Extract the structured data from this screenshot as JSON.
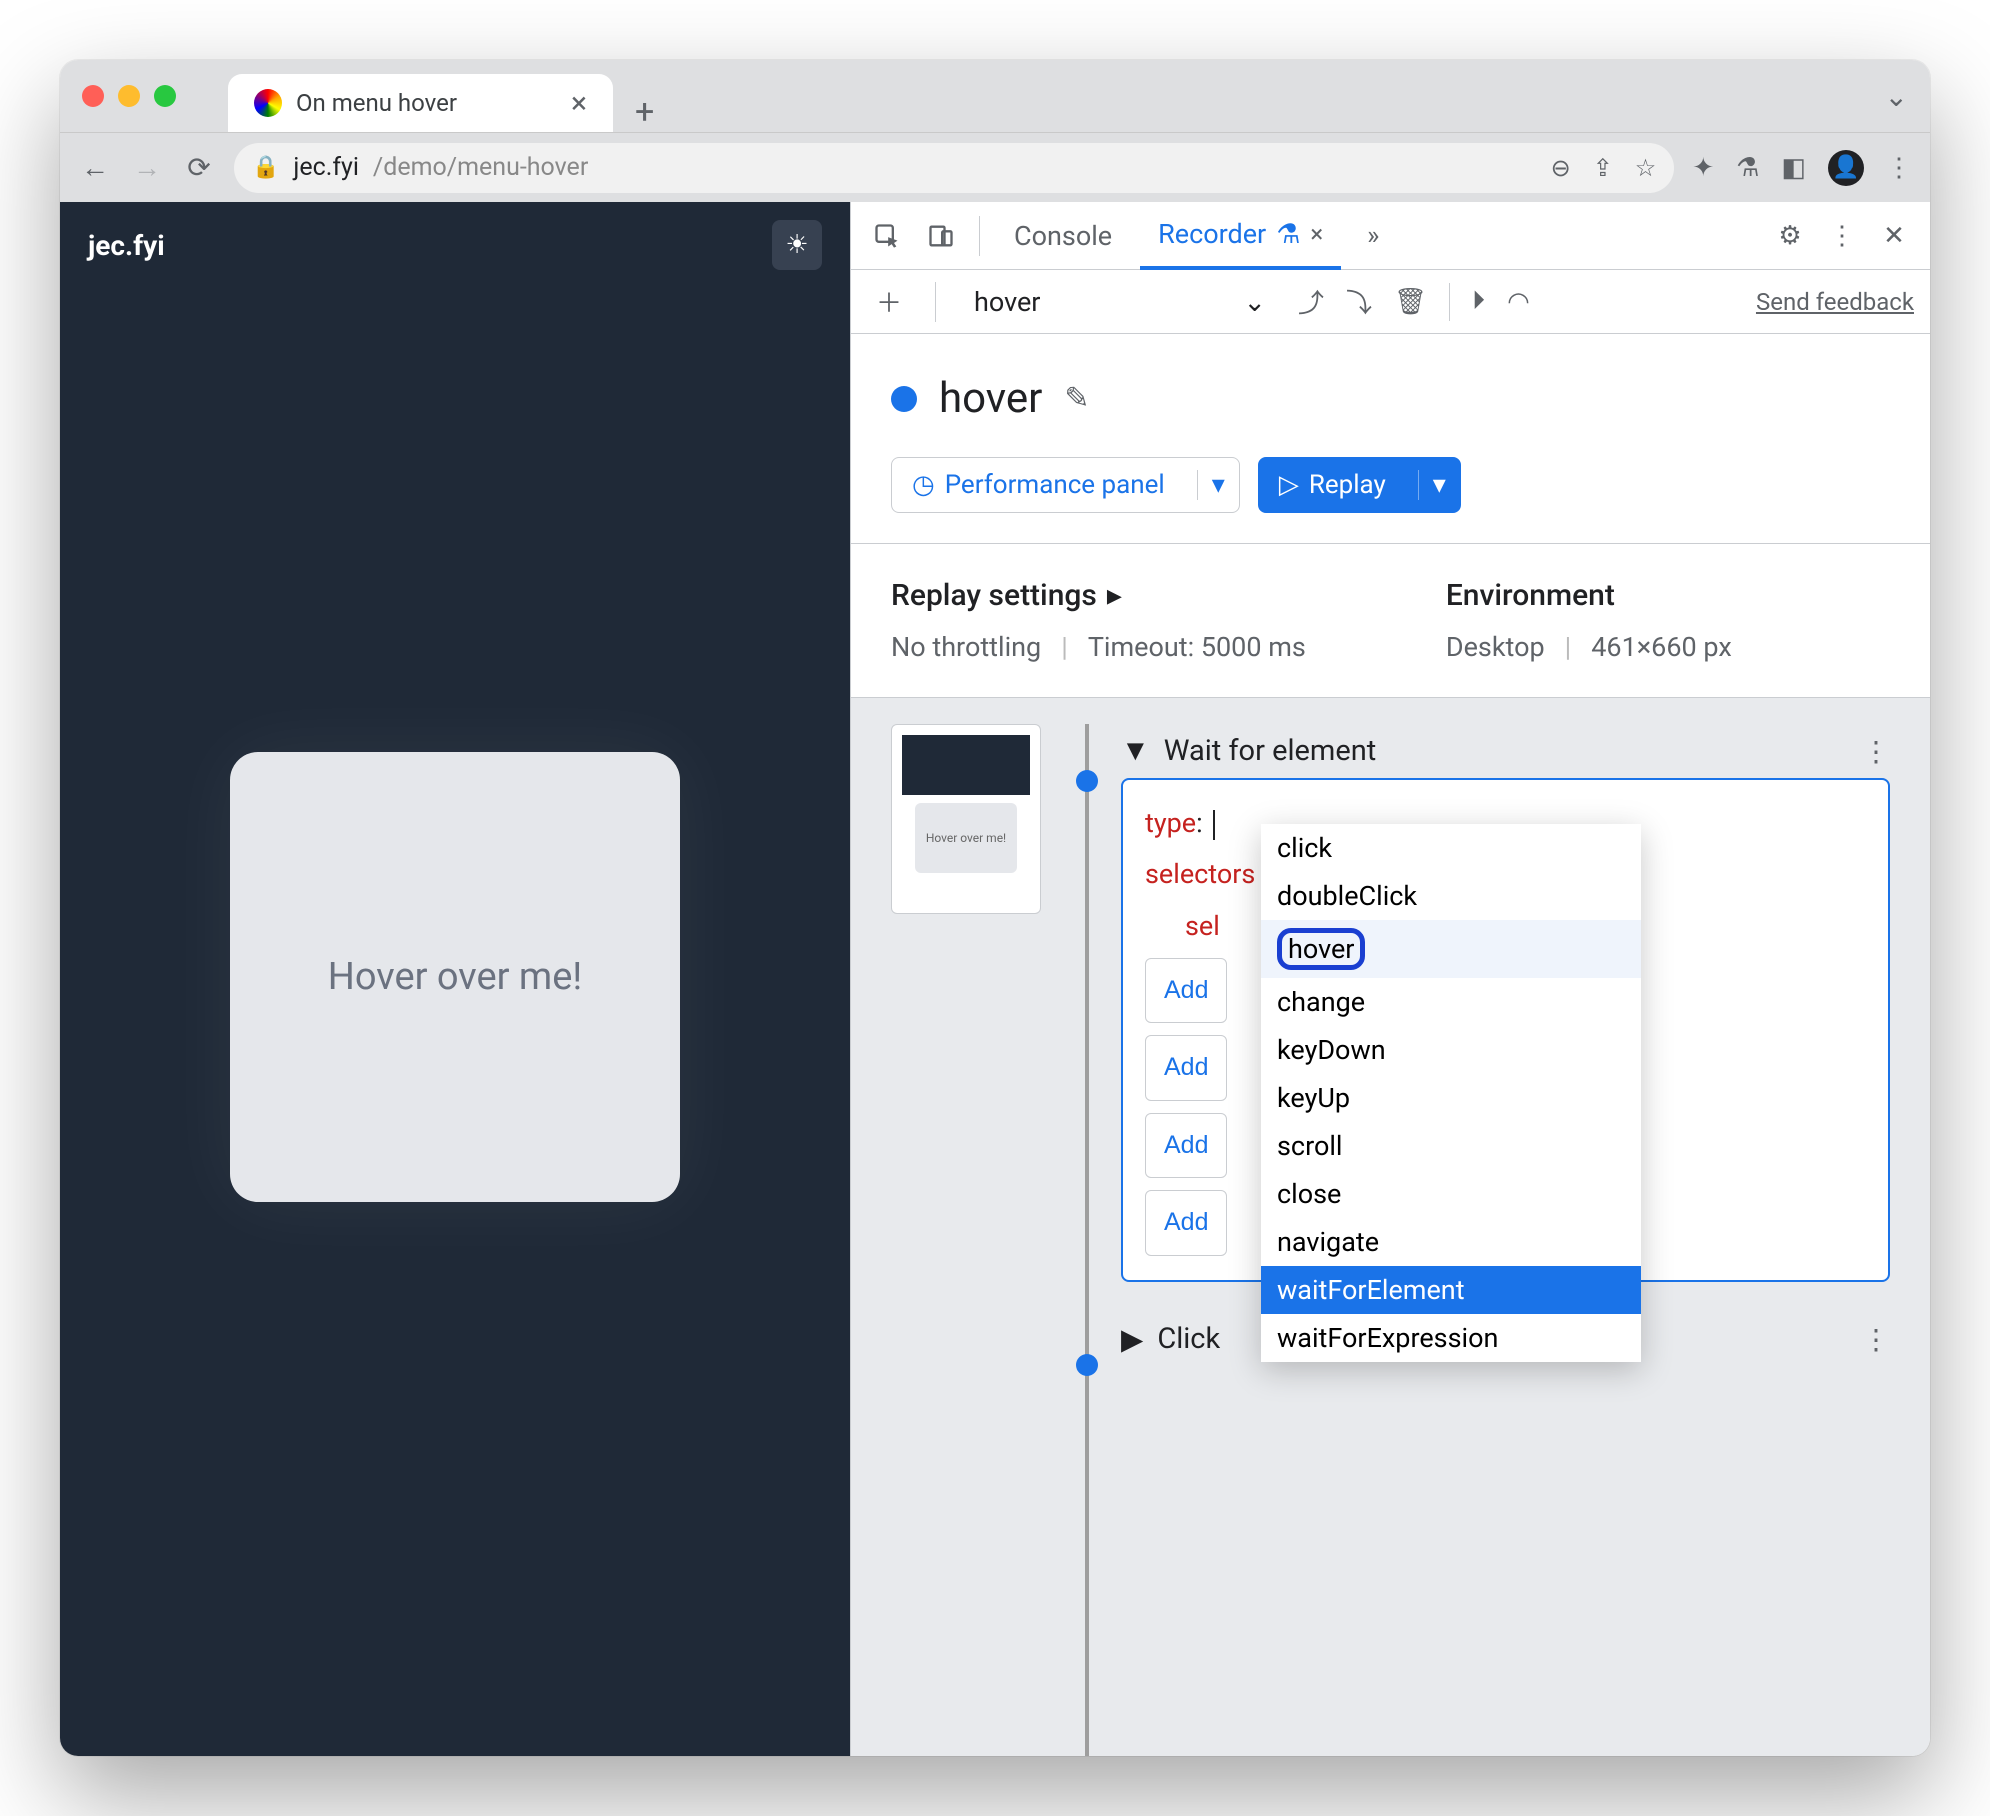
{
  "browser_tab": {
    "title": "On menu hover"
  },
  "address": {
    "domain": "jec.fyi",
    "path": "/demo/menu-hover"
  },
  "page": {
    "site_title": "jec.fyi",
    "card_text": "Hover over me!"
  },
  "devtools": {
    "tabs": {
      "console": "Console",
      "recorder": "Recorder"
    },
    "more_tabs_icon": "»",
    "recorder": {
      "recording_select": "hover",
      "feedback_link": "Send feedback",
      "title": "hover",
      "buttons": {
        "perf_panel": "Performance panel",
        "replay": "Replay"
      },
      "replay_settings": {
        "heading": "Replay settings",
        "throttling": "No throttling",
        "timeout": "Timeout: 5000 ms"
      },
      "environment": {
        "heading": "Environment",
        "device": "Desktop",
        "viewport": "461×660 px"
      },
      "thumb_label": "Hover over me!",
      "step1": {
        "title": "Wait for element"
      },
      "step_props": {
        "type_key": "type",
        "selectors_key": "selectors",
        "sel_prefix": "sel"
      },
      "add_labels": [
        "Add",
        "Add",
        "Add",
        "Add"
      ],
      "step2": {
        "title": "Click"
      },
      "dropdown_options": [
        "click",
        "doubleClick",
        "hover",
        "change",
        "keyDown",
        "keyUp",
        "scroll",
        "close",
        "navigate",
        "waitForElement",
        "waitForExpression"
      ],
      "dropdown_highlighted": "hover",
      "dropdown_selected": "waitForElement"
    }
  }
}
